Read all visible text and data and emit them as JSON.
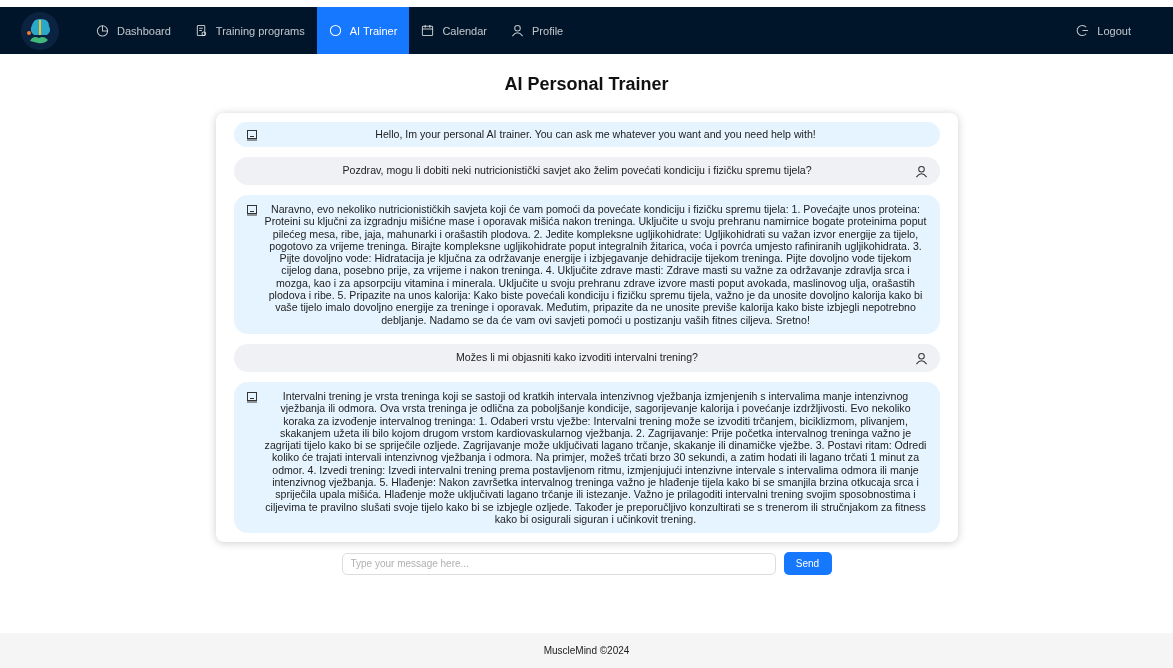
{
  "nav": {
    "items": [
      {
        "label": "Dashboard",
        "selected": false
      },
      {
        "label": "Training programs",
        "selected": false
      },
      {
        "label": "AI Trainer",
        "selected": true
      },
      {
        "label": "Calendar",
        "selected": false
      },
      {
        "label": "Profile",
        "selected": false
      }
    ],
    "logout": "Logout"
  },
  "title": "AI Personal Trainer",
  "messages": [
    {
      "kind": "bot",
      "text": "Hello, Im your personal AI trainer. You can ask me whatever you want and you need help with!"
    },
    {
      "kind": "user",
      "text": "Pozdrav, mogu li dobiti neki nutricionistički savjet ako želim povećati kondiciju i fizičku spremu tijela?"
    },
    {
      "kind": "bot",
      "text": "Naravno, evo nekoliko nutricionističkih savjeta koji će vam pomoći da povećate kondiciju i fizičku spremu tijela: 1. Povećajte unos proteina: Proteini su ključni za izgradnju mišićne mase i oporavak mišića nakon treninga. Uključite u svoju prehranu namirnice bogate proteinima poput pilećeg mesa, ribe, jaja, mahunarki i orašastih plodova. 2. Jedite kompleksne ugljikohidrate: Ugljikohidrati su važan izvor energije za tijelo, pogotovo za vrijeme treninga. Birajte kompleksne ugljikohidrate poput integralnih žitarica, voća i povrća umjesto rafiniranih ugljikohidrata. 3. Pijte dovoljno vode: Hidratacija je ključna za održavanje energije i izbjegavanje dehidracije tijekom treninga. Pijte dovoljno vode tijekom cijelog dana, posebno prije, za vrijeme i nakon treninga. 4. Uključite zdrave masti: Zdrave masti su važne za održavanje zdravlja srca i mozga, kao i za apsorpciju vitamina i minerala. Uključite u svoju prehranu zdrave izvore masti poput avokada, maslinovog ulja, orašastih plodova i ribe. 5. Pripazite na unos kalorija: Kako biste povećali kondiciju i fizičku spremu tijela, važno je da unosite dovoljno kalorija kako bi vaše tijelo imalo dovoljno energije za treninge i oporavak. Međutim, pripazite da ne unosite previše kalorija kako biste izbjegli nepotrebno debljanje. Nadamo se da će vam ovi savjeti pomoći u postizanju vaših fitnes ciljeva. Sretno!"
    },
    {
      "kind": "user",
      "text": "Možes li mi objasniti kako izvoditi intervalni trening?"
    },
    {
      "kind": "bot",
      "text": "Intervalni trening je vrsta treninga koji se sastoji od kratkih intervala intenzivnog vježbanja izmjenjenih s intervalima manje intenzivnog vježbanja ili odmora. Ova vrsta treninga je odlična za poboljšanje kondicije, sagorijevanje kalorija i povećanje izdržljivosti. Evo nekoliko koraka za izvođenje intervalnog treninga: 1. Odaberi vrstu vježbe: Intervalni trening može se izvoditi trčanjem, biciklizmom, plivanjem, skakanjem užeta ili bilo kojom drugom vrstom kardiovaskularnog vježbanja. 2. Zagrijavanje: Prije početka intervalnog treninga važno je zagrijati tijelo kako bi se spriječile ozljede. Zagrijavanje može uključivati lagano trčanje, skakanje ili dinamičke vježbe. 3. Postavi ritam: Odredi koliko će trajati intervali intenzivnog vježbanja i odmora. Na primjer, možeš trčati brzo 30 sekundi, a zatim hodati ili lagano trčati 1 minut za odmor. 4. Izvedi trening: Izvedi intervalni trening prema postavljenom ritmu, izmjenjujući intenzivne intervale s intervalima odmora ili manje intenzivnog vježbanja. 5. Hlađenje: Nakon završetka intervalnog treninga važno je hlađenje tijela kako bi se smanjila brzina otkucaja srca i spriječila upala mišića. Hlađenje može uključivati lagano trčanje ili istezanje. Važno je prilagoditi intervalni trening svojim sposobnostima i ciljevima te pravilno slušati svoje tijelo kako bi se izbjegle ozljede. Također je preporučljivo konzultirati se s trenerom ili stručnjakom za fitness kako bi osigurali siguran i učinkovit trening."
    }
  ],
  "input": {
    "placeholder": "Type your message here..."
  },
  "send": "Send",
  "footer": "MuscleMind ©2024"
}
